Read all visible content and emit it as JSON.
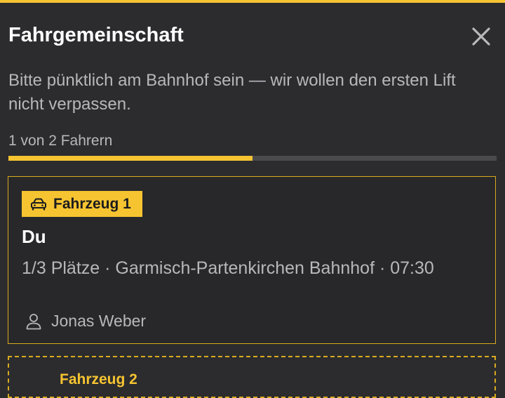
{
  "colors": {
    "accent": "#f6c431",
    "background": "#2c2c2e",
    "text_primary": "#ffffff",
    "text_secondary": "#b8b8bc"
  },
  "header": {
    "title": "Fahrgemeinschaft",
    "close_icon": "close-icon"
  },
  "message": "Bitte pünktlich am Bahnhof sein — wir wollen den ersten Lift nicht verpassen.",
  "progress": {
    "label": "1 von 2 Fahrern",
    "filled": 1,
    "total": 2
  },
  "vehicles": [
    {
      "label": "Fahrzeug 1",
      "icon": "car-icon",
      "driver": "Du",
      "details": "1/3 Plätze · Garmisch-Partenkirchen Bahnhof · 07:30",
      "passengers": [
        {
          "name": "Jonas Weber",
          "icon": "person-icon"
        }
      ]
    },
    {
      "label": "Fahrzeug 2"
    }
  ]
}
